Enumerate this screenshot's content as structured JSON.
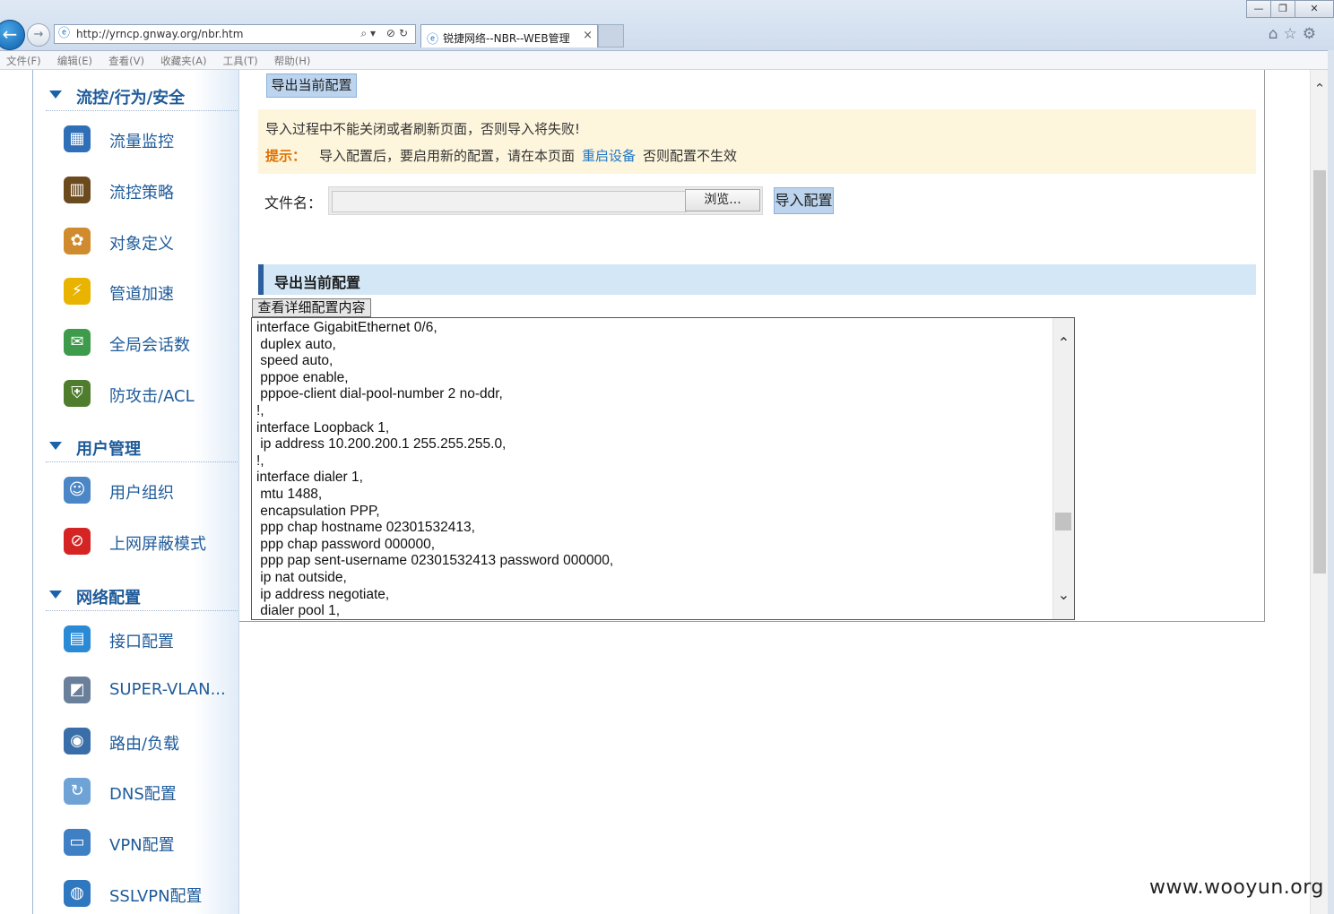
{
  "browser": {
    "url": "http://yrncp.gnway.org/nbr.htm",
    "tab_title": "锐捷网络--NBR--WEB管理",
    "tab_close": "×",
    "back_glyph": "←",
    "forward_glyph": "→",
    "address_tools": "⌕▾ ⊘↻",
    "right_icons": "⌂☆⚙",
    "window_controls": {
      "minimize": "—",
      "restore": "❐",
      "close": "✕"
    },
    "menu": [
      "文件(F)",
      "编辑(E)",
      "查看(V)",
      "收藏夹(A)",
      "工具(T)",
      "帮助(H)"
    ]
  },
  "sidebar": {
    "groups": [
      {
        "title": "流控/行为/安全",
        "items": [
          {
            "label": "流量监控",
            "icon": "monitor-chart-icon",
            "color": "#2e6fb7",
            "glyph": "▦"
          },
          {
            "label": "流控策略",
            "icon": "policy-icon",
            "color": "#6b4a1e",
            "glyph": "▥"
          },
          {
            "label": "对象定义",
            "icon": "palette-icon",
            "color": "#d08b2f",
            "glyph": "✿"
          },
          {
            "label": "管道加速",
            "icon": "lightning-icon",
            "color": "#e8b400",
            "glyph": "⚡"
          },
          {
            "label": "全局会话数",
            "icon": "chat-bubbles-icon",
            "color": "#3f9b4c",
            "glyph": "✉"
          },
          {
            "label": "防攻击/ACL",
            "icon": "shield-icon",
            "color": "#4f7d2d",
            "glyph": "⛨"
          }
        ]
      },
      {
        "title": "用户管理",
        "items": [
          {
            "label": "用户组织",
            "icon": "user-group-icon",
            "color": "#4b86c7",
            "glyph": "☺"
          },
          {
            "label": "上网屏蔽模式",
            "icon": "block-icon",
            "color": "#d42424",
            "glyph": "⊘"
          }
        ]
      },
      {
        "title": "网络配置",
        "items": [
          {
            "label": "接口配置",
            "icon": "interface-icon",
            "color": "#2a8ad6",
            "glyph": "▤"
          },
          {
            "label": "SUPER-VLAN...",
            "icon": "vlan-icon",
            "color": "#6a7f9a",
            "glyph": "◩"
          },
          {
            "label": "路由/负载",
            "icon": "router-icon",
            "color": "#3a6ea8",
            "glyph": "◉"
          },
          {
            "label": "DNS配置",
            "icon": "dns-icon",
            "color": "#6fa3d6",
            "glyph": "↻"
          },
          {
            "label": "VPN配置",
            "icon": "vpn-computer-icon",
            "color": "#3f7fc4",
            "glyph": "▭"
          },
          {
            "label": "SSLVPN配置",
            "icon": "globe-icon",
            "color": "#2f78c0",
            "glyph": "◍"
          }
        ]
      }
    ]
  },
  "content": {
    "export_top_button": "导出当前配置",
    "notice_line1": "导入过程中不能关闭或者刷新页面，否则导入将失败!",
    "tip_label": "提示：",
    "tip_text_before": "导入配置后，要启用新的配置，请在本页面",
    "tip_link": "重启设备",
    "tip_text_after": "否则配置不生效",
    "file_label": "文件名：",
    "browse_button": "浏览...",
    "import_button": "导入配置",
    "section_title": "导出当前配置",
    "view_button": "查看详细配置内容",
    "config_lines": [
      "interface GigabitEthernet 0/6,",
      " duplex auto,",
      " speed auto,",
      " pppoe enable,",
      " pppoe-client dial-pool-number 2 no-ddr,",
      "!,",
      "interface Loopback 1,",
      " ip address 10.200.200.1 255.255.255.0,",
      "!,",
      "interface dialer 1,",
      " mtu 1488,",
      " encapsulation PPP,",
      " ppp chap hostname 02301532413,",
      " ppp chap password 000000,",
      " ppp pap sent-username 02301532413 password 000000,",
      " ip nat outside,",
      " ip address negotiate,",
      " dialer pool 1,"
    ],
    "scroll_up": "⌃",
    "scroll_down": "⌄"
  },
  "watermark": "www.wooyun.org"
}
